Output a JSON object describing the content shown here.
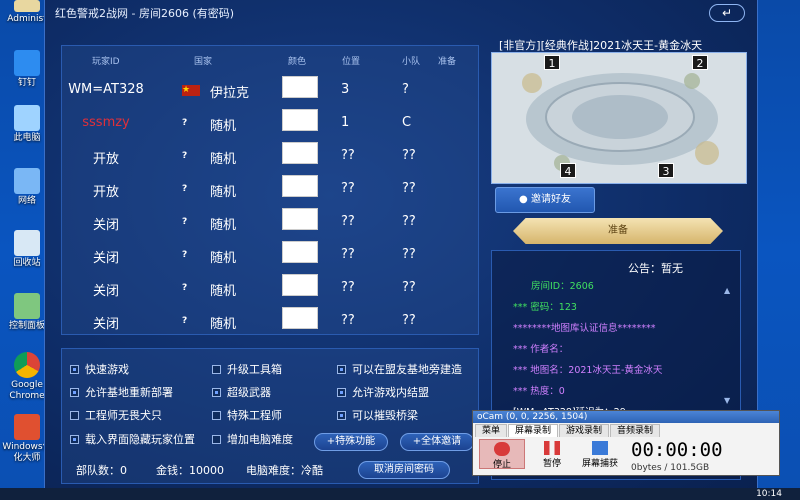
{
  "desktop": {
    "icons": [
      {
        "label": "Administ"
      },
      {
        "label": "钉钉"
      },
      {
        "label": "此电脑"
      },
      {
        "label": "网络"
      },
      {
        "label": "回收站"
      },
      {
        "label": "控制面板"
      },
      {
        "label": "Google\nChrome"
      },
      {
        "label": "Windows优化大师"
      }
    ]
  },
  "taskbar": {
    "clock": "10:14"
  },
  "game": {
    "title": "红色警戒2战网 - 房间2606 (有密码)",
    "back_label": "↵",
    "table_headers": {
      "id": "玩家ID",
      "country": "国家",
      "color": "颜色",
      "position": "位置",
      "team": "小队",
      "ready": "准备"
    },
    "players": [
      {
        "id": "WM=AT328",
        "flag": "★",
        "country": "伊拉克",
        "position": "3",
        "team": "?",
        "id_color": "#ffffff"
      },
      {
        "id": "sssmzy",
        "flag": "?",
        "country": "随机",
        "position": "1",
        "team": "C",
        "id_color": "#e0303a"
      },
      {
        "id": "开放",
        "flag": "?",
        "country": "随机",
        "position": "??",
        "team": "??",
        "id_color": "#ffffff"
      },
      {
        "id": "开放",
        "flag": "?",
        "country": "随机",
        "position": "??",
        "team": "??",
        "id_color": "#ffffff"
      },
      {
        "id": "关闭",
        "flag": "?",
        "country": "随机",
        "position": "??",
        "team": "??",
        "id_color": "#ffffff"
      },
      {
        "id": "关闭",
        "flag": "?",
        "country": "随机",
        "position": "??",
        "team": "??",
        "id_color": "#ffffff"
      },
      {
        "id": "关闭",
        "flag": "?",
        "country": "随机",
        "position": "??",
        "team": "??",
        "id_color": "#ffffff"
      },
      {
        "id": "关闭",
        "flag": "?",
        "country": "随机",
        "position": "??",
        "team": "??",
        "id_color": "#ffffff"
      }
    ],
    "options": [
      {
        "label": "快速游戏",
        "checked": true
      },
      {
        "label": "升级工具箱",
        "checked": false
      },
      {
        "label": "可以在盟友基地旁建造",
        "checked": true
      },
      {
        "label": "允许基地重新部署",
        "checked": true
      },
      {
        "label": "超级武器",
        "checked": true
      },
      {
        "label": "允许游戏内结盟",
        "checked": true
      },
      {
        "label": "工程师无畏犬只",
        "checked": false
      },
      {
        "label": "特殊工程师",
        "checked": false
      },
      {
        "label": "可以摧毁桥梁",
        "checked": true
      },
      {
        "label": "载入界面隐藏玩家位置",
        "checked": true
      },
      {
        "label": "增加电脑难度",
        "checked": false
      }
    ],
    "special_btn": "+特殊功能",
    "invite_all_btn": "+全体邀请",
    "cancel_pwd_btn": "取消房间密码",
    "stats": {
      "units": "部队数：0",
      "money": "金钱：10000",
      "ai_difficulty": "电脑难度：冷酷"
    },
    "map_title": "[非官方][经典作战]2021冰天王-黄金冰天",
    "map_slots": [
      "1",
      "2",
      "3",
      "4"
    ],
    "invite_friend_btn": "邀请好友",
    "ready_btn": "准备",
    "announce": "公告：暂无",
    "log_lines": [
      {
        "text": "房间ID：2606",
        "color": "#40e060"
      },
      {
        "text": "*** 密码：123",
        "color": "#40e060"
      },
      {
        "text": "********地图库认证信息********",
        "color": "#d080ff"
      },
      {
        "text": "*** 作者名：",
        "color": "#d080ff"
      },
      {
        "text": "*** 地图名：2021冰天王-黄金冰天",
        "color": "#d080ff"
      },
      {
        "text": "*** 热度：0",
        "color": "#d080ff"
      },
      {
        "text": "[WM=AT328]延迟为：29",
        "color": "#ffffff"
      }
    ]
  },
  "ocam": {
    "title": "oCam (0, 0, 2256, 1504)",
    "tabs": [
      "菜单",
      "屏幕录制",
      "游戏录制",
      "音频录制"
    ],
    "active_tab": 1,
    "buttons": {
      "stop": "停止",
      "pause": "暂停",
      "capture": "屏幕捕获"
    },
    "time": "00:00:00",
    "sub": "0bytes / 101.5GB"
  }
}
